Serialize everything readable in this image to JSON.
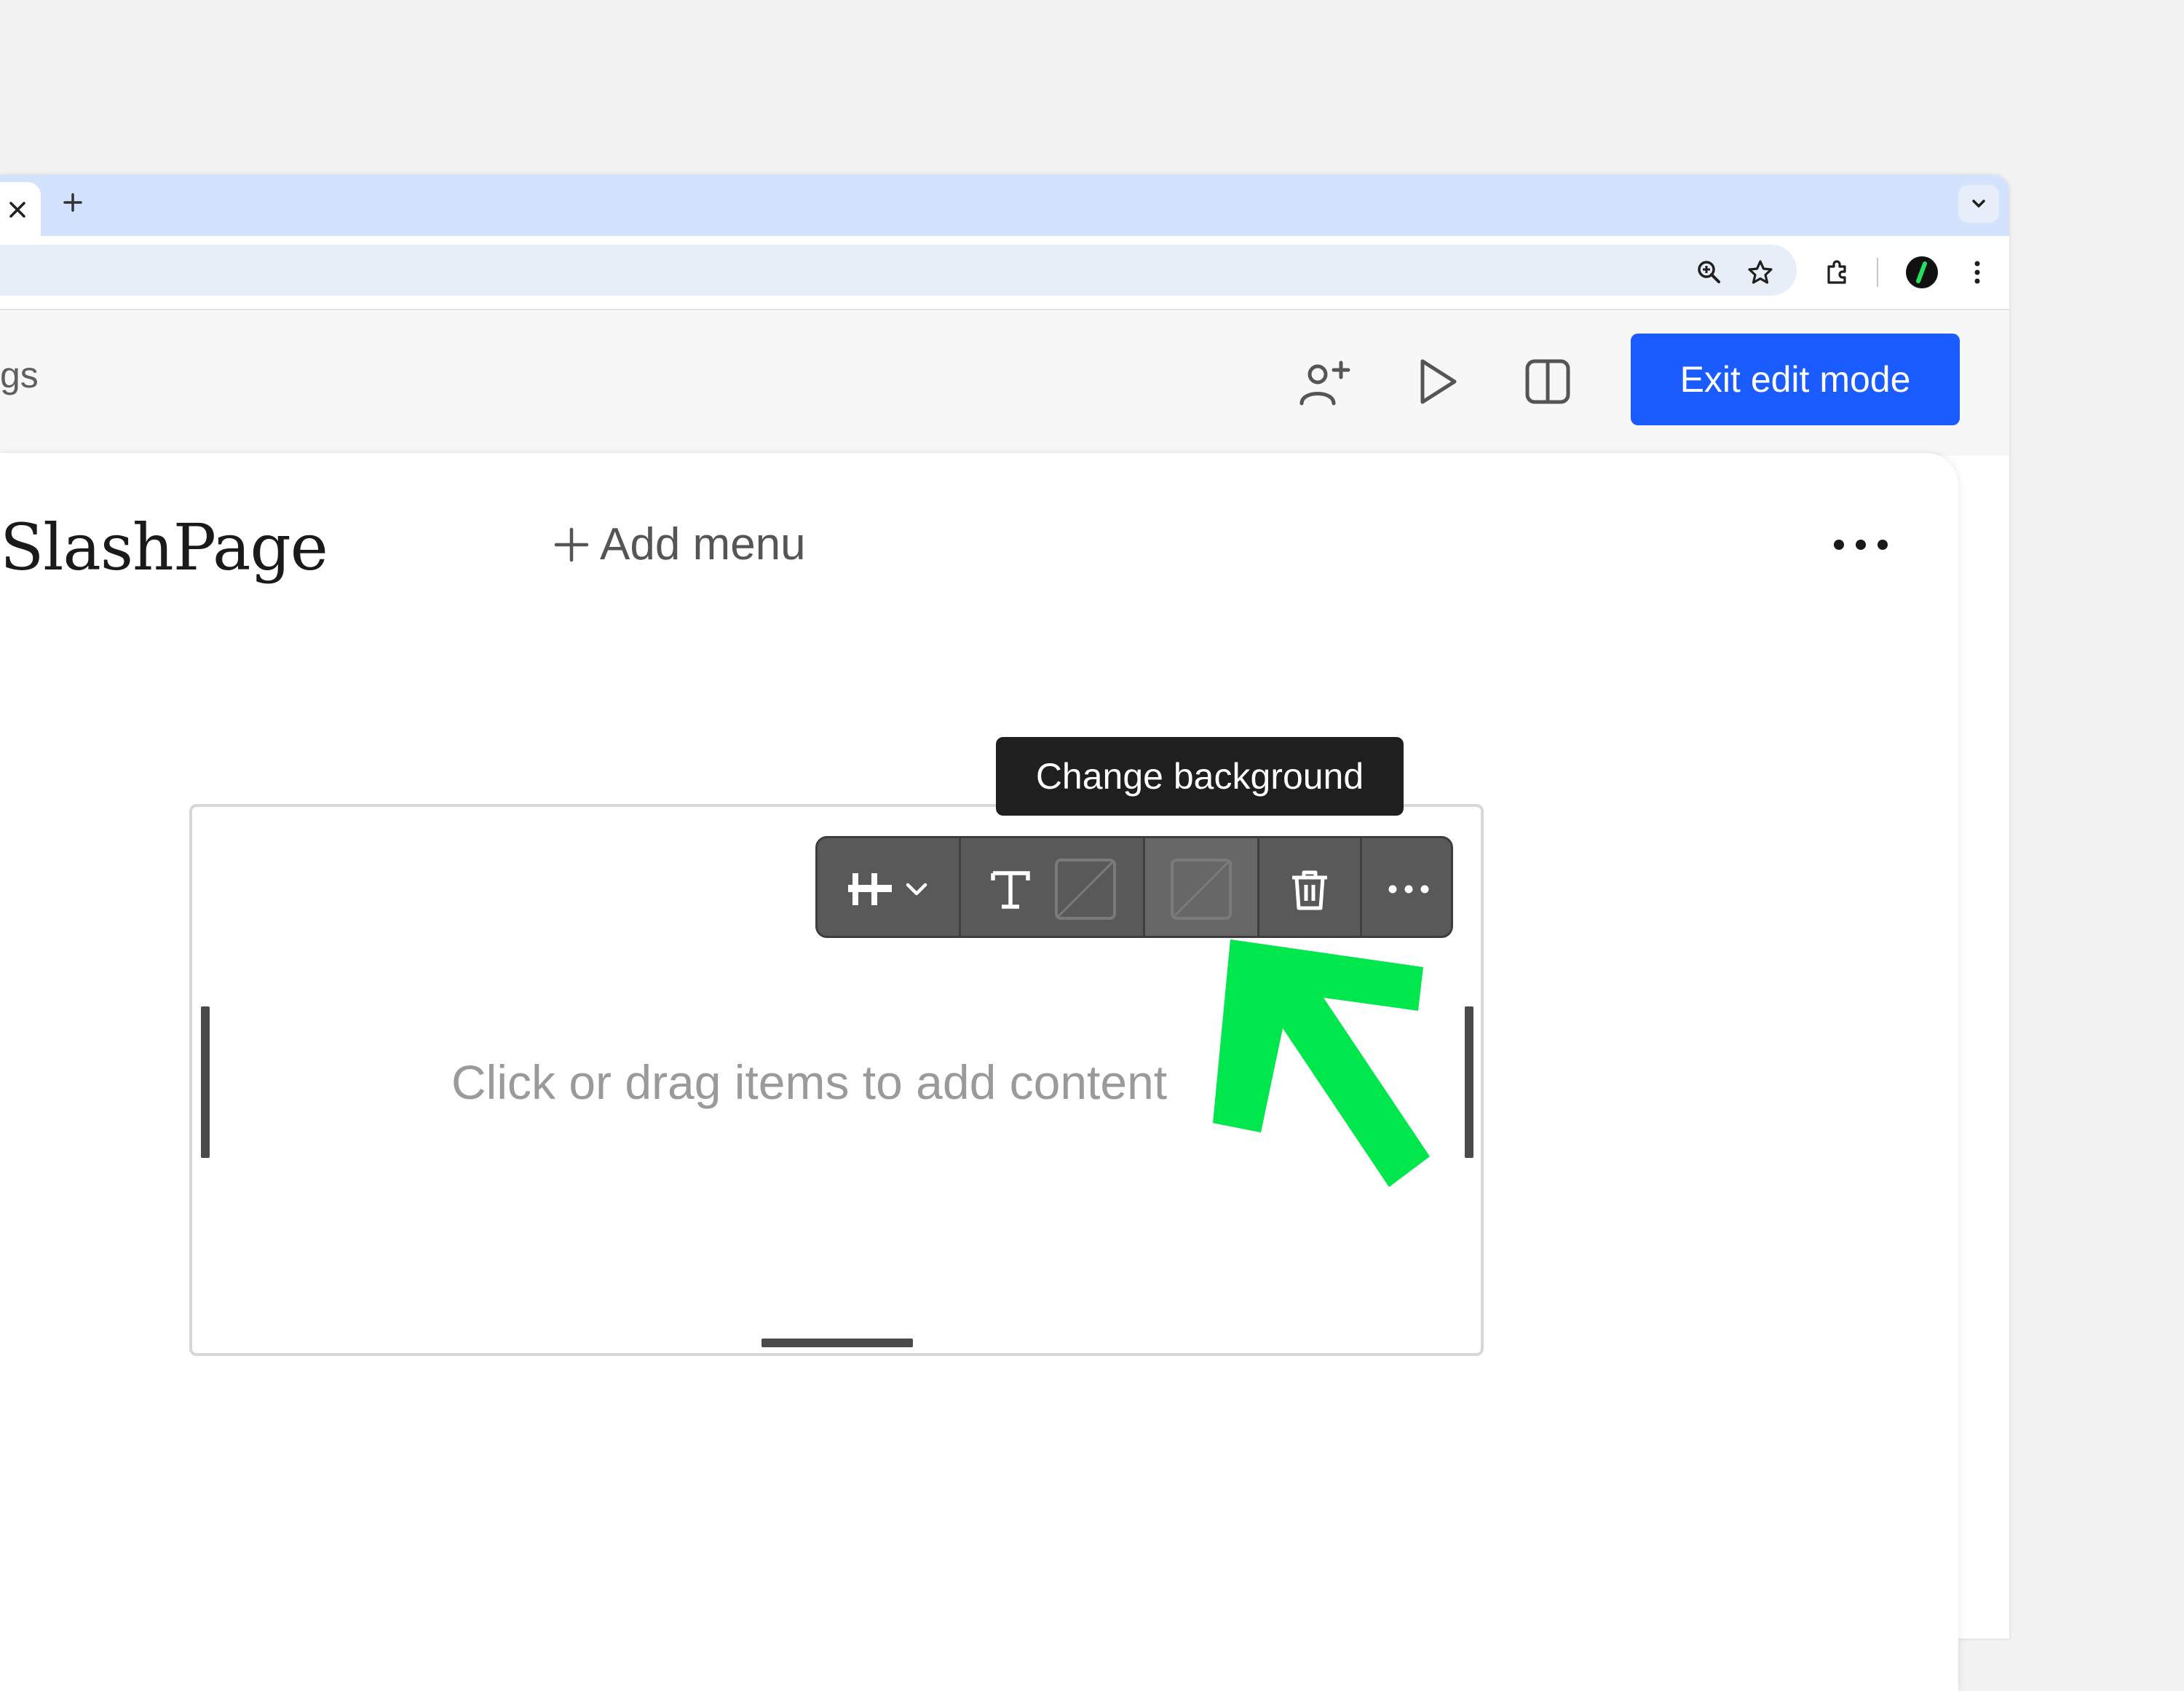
{
  "browser": {
    "tab_close_icon": "close-icon",
    "new_tab_icon": "plus-icon",
    "tab_dropdown_icon": "chevron-down-icon",
    "toolbar_icons": [
      "zoom-icon",
      "star-icon",
      "extension-puzzle-icon",
      "profile-slash-icon",
      "more-vertical-icon"
    ]
  },
  "header": {
    "breadcrumb_fragment": "gs",
    "icons": [
      "add-person-icon",
      "play-icon",
      "split-view-icon"
    ],
    "exit_button_label": "Exit edit mode"
  },
  "page": {
    "site_title": "SlashPage",
    "add_menu_label": "Add menu",
    "more_icon": "more-horizontal-icon"
  },
  "section": {
    "empty_placeholder": "Click or drag items to add content"
  },
  "section_toolbar": {
    "tooltip": "Change background",
    "buttons": [
      "layout-align-icon",
      "chevron-down-icon",
      "text-icon",
      "text-color-swatch-icon",
      "background-swatch-icon",
      "trash-icon",
      "more-horizontal-icon"
    ]
  },
  "colors": {
    "accent": "#1a5cff",
    "annotation_arrow": "#00e64d",
    "tab_strip": "#d3e3fd",
    "toolbar_bg": "#595959"
  }
}
